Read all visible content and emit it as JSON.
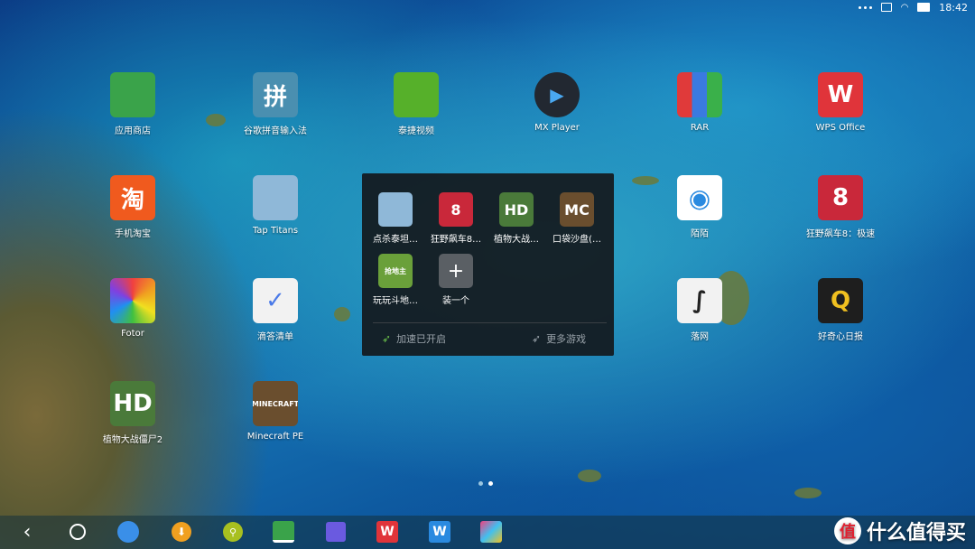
{
  "status_bar": {
    "time": "18:42"
  },
  "apps": [
    {
      "label": "应用商店",
      "icon": "app-store-icon",
      "color": "#3aa34a"
    },
    {
      "label": "谷歌拼音输入法",
      "icon": "keyboard-icon",
      "glyph": "拼",
      "color": "#4a8fb0"
    },
    {
      "label": "泰捷视频",
      "icon": "video-icon",
      "color": "#56b02a"
    },
    {
      "label": "MX Player",
      "icon": "play-icon",
      "color": "#222831"
    },
    {
      "label": "RAR",
      "icon": "archive-icon",
      "color": "#7a3a8a"
    },
    {
      "label": "WPS Office",
      "icon": "wps-icon",
      "glyph": "W",
      "color": "#e0343a"
    },
    {
      "label": "手机淘宝",
      "icon": "taobao-icon",
      "glyph": "淘",
      "color": "#f05a1e"
    },
    {
      "label": "Tap Titans",
      "icon": "game-icon",
      "color": "#8fb8d8"
    },
    {
      "label": "陌陌",
      "icon": "chat-icon",
      "color": "#ffffff"
    },
    {
      "label": "狂野飙车8：极速",
      "icon": "racing-icon",
      "glyph": "8",
      "color": "#c9283a"
    },
    {
      "label": "Fotor",
      "icon": "camera-icon",
      "color": "#e8402c"
    },
    {
      "label": "滴答清单",
      "icon": "checklist-icon",
      "color": "#f2f2f2"
    },
    {
      "label": "落网",
      "icon": "swan-icon",
      "color": "#f2f2f2"
    },
    {
      "label": "好奇心日报",
      "icon": "q-icon",
      "glyph": "Q",
      "color": "#1e1e1e"
    },
    {
      "label": "植物大战僵尸2",
      "icon": "zombie-icon",
      "glyph": "HD",
      "color": "#4a7a3a"
    },
    {
      "label": "Minecraft PE",
      "icon": "minecraft-icon",
      "glyph": "MINECRAFT",
      "color": "#6a4e2e"
    }
  ],
  "folder": {
    "apps": [
      {
        "label": "点杀泰坦…",
        "icon": "game-icon",
        "color": "#8fb8d8"
      },
      {
        "label": "狂野飙车8…",
        "icon": "racing-icon",
        "glyph": "8",
        "color": "#c9283a"
      },
      {
        "label": "植物大战…",
        "icon": "zombie-icon",
        "glyph": "HD",
        "color": "#4a7a3a"
      },
      {
        "label": "口袋沙盘(…",
        "icon": "minecraft-icon",
        "glyph": "MC",
        "color": "#6a4e2e"
      },
      {
        "label": "玩玩斗地…",
        "icon": "cards-icon",
        "glyph": "抢地主",
        "color": "#6aa03a"
      },
      {
        "label": "装一个",
        "icon": "plus-icon",
        "glyph": "+",
        "color": "#5a5f64"
      }
    ],
    "boost_label": "加速已开启",
    "more_games_label": "更多游戏"
  },
  "dock": {
    "watermark": "什么值得买"
  },
  "colors": {
    "pager_active": "#ffffff",
    "pager_inactive": "#9ac6e0"
  }
}
